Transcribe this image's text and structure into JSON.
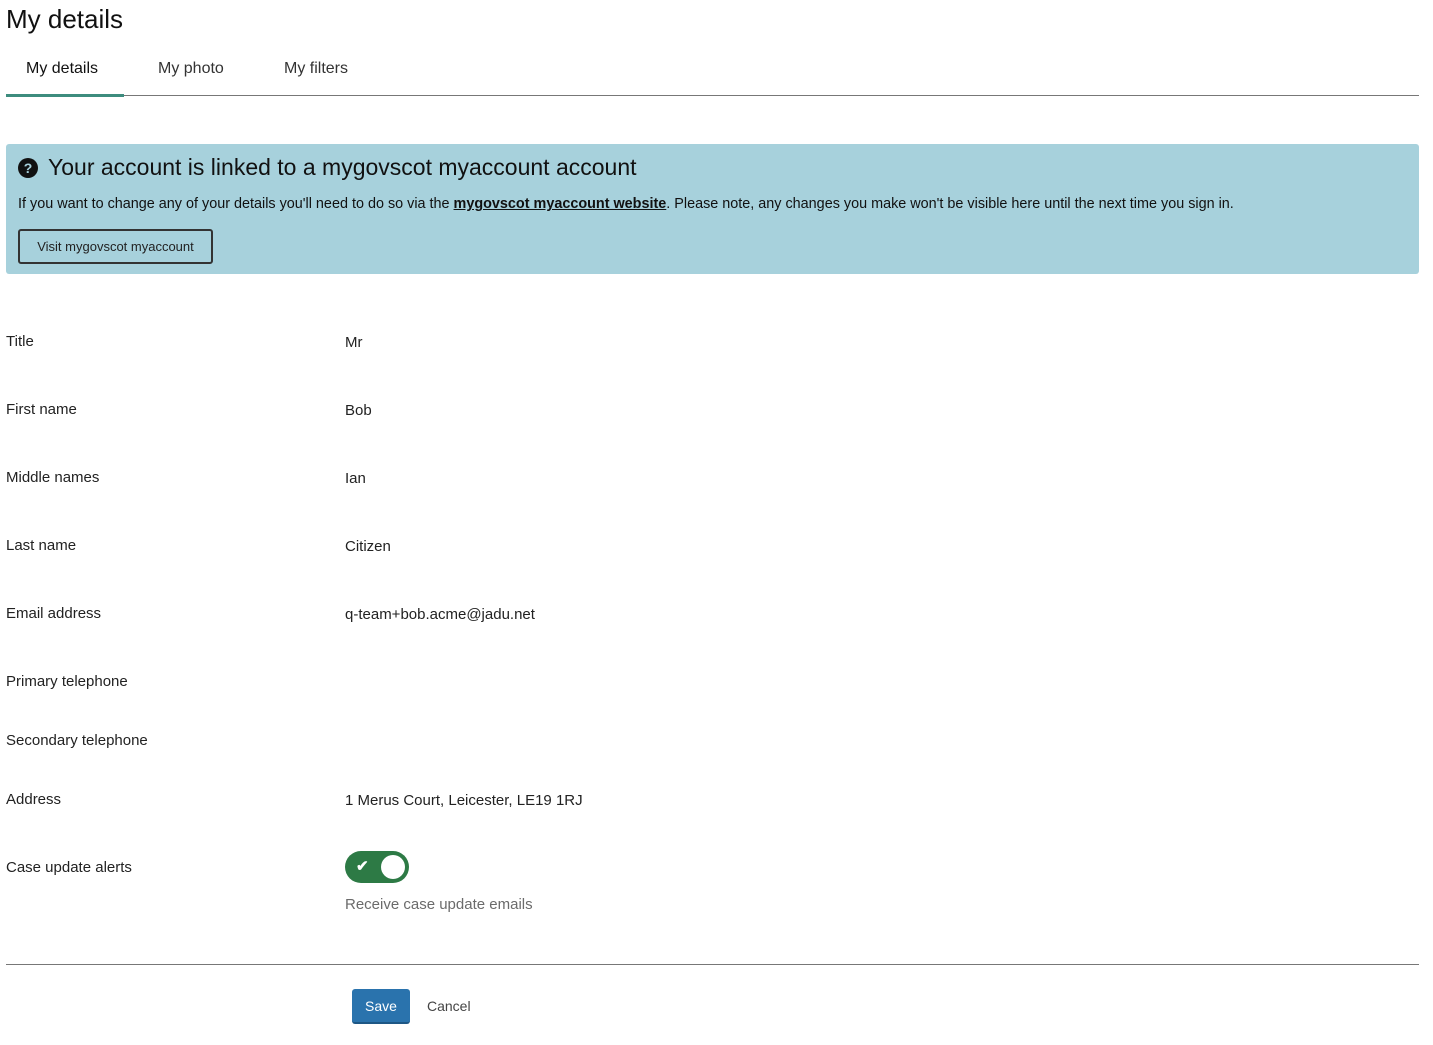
{
  "page": {
    "title": "My details"
  },
  "tabs": [
    {
      "label": "My details",
      "active": true
    },
    {
      "label": "My photo",
      "active": false
    },
    {
      "label": "My filters",
      "active": false
    }
  ],
  "alert": {
    "icon": "question-circle-icon",
    "heading": "Your account is linked to a mygovscot myaccount account",
    "body_before": "If you want to change any of your details you'll need to do so via the ",
    "link_text": "mygovscot myaccount website",
    "body_after": ". Please note, any changes you make won't be visible here until the next time you sign in.",
    "button_label": "Visit mygovscot myaccount",
    "background_color": "#a7d1dc"
  },
  "fields": [
    {
      "label": "Title",
      "value": "Mr"
    },
    {
      "label": "First name",
      "value": "Bob"
    },
    {
      "label": "Middle names",
      "value": "Ian"
    },
    {
      "label": "Last name",
      "value": "Citizen"
    },
    {
      "label": "Email address",
      "value": "q-team+bob.acme@jadu.net"
    },
    {
      "label": "Primary telephone",
      "value": ""
    },
    {
      "label": "Secondary telephone",
      "value": ""
    },
    {
      "label": "Address",
      "value": "1 Merus Court, Leicester, LE19 1RJ"
    }
  ],
  "case_alerts": {
    "label": "Case update alerts",
    "enabled": true,
    "check_icon": "✔",
    "help_text": "Receive case update emails",
    "toggle_color": "#2d7a45"
  },
  "actions": {
    "save_label": "Save",
    "cancel_label": "Cancel",
    "save_color": "#2a73ad"
  }
}
